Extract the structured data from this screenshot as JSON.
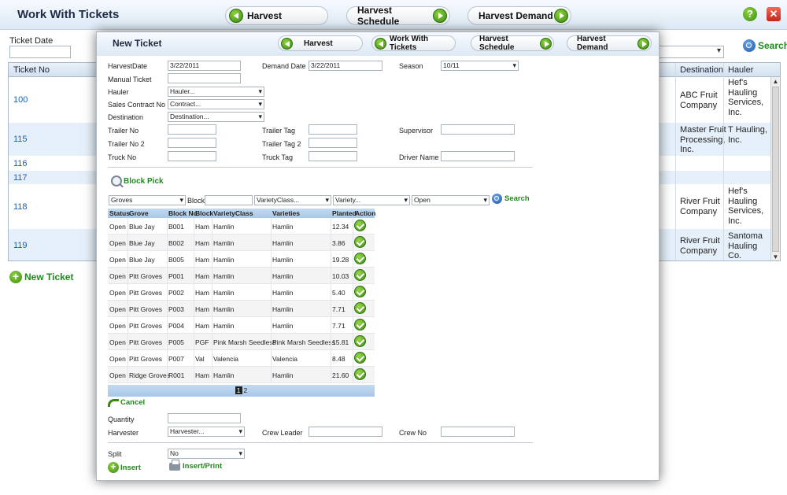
{
  "page": {
    "title": "Work With Tickets",
    "nav": [
      "Harvest",
      "Harvest Schedule",
      "Harvest Demand"
    ],
    "ticket_date_label": "Ticket Date",
    "search_label": "Search",
    "new_ticket_label": "New Ticket",
    "help_glyph": "?",
    "close_glyph": "✕",
    "table_headers": {
      "ticket_no": "Ticket No",
      "destination": "Destination",
      "hauler": "Hauler"
    },
    "rows": [
      {
        "ticket_no": "100",
        "destination": "ABC Fruit Company",
        "hauler": "Hef's Hauling Services, Inc."
      },
      {
        "ticket_no": "115",
        "destination": "Master Fruit Processing, Inc.",
        "hauler": "T Hauling, Inc."
      },
      {
        "ticket_no": "116",
        "destination": "",
        "hauler": ""
      },
      {
        "ticket_no": "117",
        "destination": "",
        "hauler": ""
      },
      {
        "ticket_no": "118",
        "destination": "River Fruit Company",
        "hauler": "Hef's Hauling Services, Inc."
      },
      {
        "ticket_no": "119",
        "destination": "River Fruit Company",
        "hauler": "Santoma Hauling Co."
      }
    ]
  },
  "modal": {
    "title": "New Ticket",
    "nav": [
      "Harvest",
      "Work With Tickets",
      "Harvest Schedule",
      "Harvest Demand"
    ],
    "fields": {
      "harvest_date_label": "HarvestDate",
      "harvest_date_value": "3/22/2011",
      "demand_date_label": "Demand Date",
      "demand_date_value": "3/22/2011",
      "season_label": "Season",
      "season_value": "10/11",
      "manual_ticket_label": "Manual Ticket",
      "hauler_label": "Hauler",
      "hauler_value": "Hauler...",
      "sales_contract_label": "Sales Contract No",
      "sales_contract_value": "Contract...",
      "destination_label": "Destination",
      "destination_value": "Destination...",
      "trailer_no_label": "Trailer No",
      "trailer_tag_label": "Trailer Tag",
      "supervisor_label": "Supervisor",
      "trailer_no2_label": "Trailer No 2",
      "trailer_tag2_label": "Trailer Tag 2",
      "truck_no_label": "Truck No",
      "truck_tag_label": "Truck Tag",
      "driver_name_label": "Driver Name"
    },
    "block_pick_label": "Block Pick",
    "filters": {
      "groves": "Groves",
      "block_label": "Block",
      "variety_class": "VarietyClass...",
      "variety": "Variety...",
      "status": "Open",
      "search": "Search"
    },
    "grid_headers": [
      "Status",
      "Grove",
      "Block No",
      "Block",
      "VarietyClass",
      "Varieties",
      "Planted",
      "Action"
    ],
    "grid_rows": [
      [
        "Open",
        "Blue Jay",
        "B001",
        "Ham",
        "Hamlin",
        "Hamlin",
        "12.34"
      ],
      [
        "Open",
        "Blue Jay",
        "B002",
        "Ham",
        "Hamlin",
        "Hamlin",
        "3.86"
      ],
      [
        "Open",
        "Blue Jay",
        "B005",
        "Ham",
        "Hamlin",
        "Hamlin",
        "19.28"
      ],
      [
        "Open",
        "Pitt Groves",
        "P001",
        "Ham",
        "Hamlin",
        "Hamlin",
        "10.03"
      ],
      [
        "Open",
        "Pitt Groves",
        "P002",
        "Ham",
        "Hamlin",
        "Hamlin",
        "5.40"
      ],
      [
        "Open",
        "Pitt Groves",
        "P003",
        "Ham",
        "Hamlin",
        "Hamlin",
        "7.71"
      ],
      [
        "Open",
        "Pitt Groves",
        "P004",
        "Ham",
        "Hamlin",
        "Hamlin",
        "7.71"
      ],
      [
        "Open",
        "Pitt Groves",
        "P005",
        "PGF",
        "Pink Marsh Seedless",
        "Pink Marsh Seedless",
        "15.81"
      ],
      [
        "Open",
        "Pitt Groves",
        "P007",
        "Val",
        "Valencia",
        "Valencia",
        "8.48"
      ],
      [
        "Open",
        "Ridge Groves",
        "R001",
        "Ham",
        "Hamlin",
        "Hamlin",
        "21.60"
      ]
    ],
    "pager": {
      "current": "1",
      "next": "2"
    },
    "cancel_label": "Cancel",
    "quantity_label": "Quantity",
    "harvester_label": "Harvester",
    "harvester_value": "Harvester...",
    "crew_leader_label": "Crew Leader",
    "crew_no_label": "Crew No",
    "split_label": "Split",
    "split_value": "No",
    "insert_label": "Insert",
    "insert_print_label": "Insert/Print"
  }
}
